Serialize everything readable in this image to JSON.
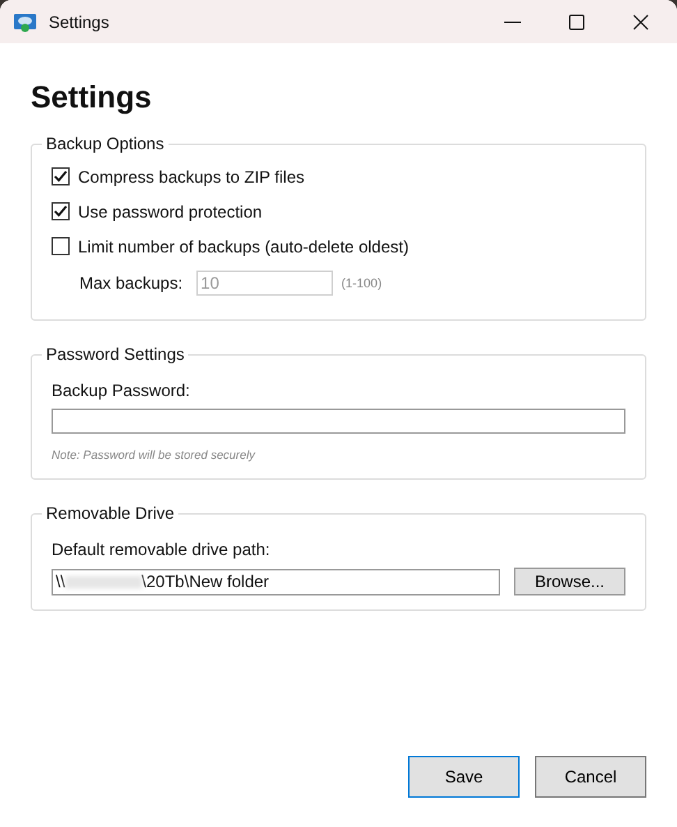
{
  "window": {
    "title": "Settings"
  },
  "heading": "Settings",
  "backup_options": {
    "title": "Backup Options",
    "checkboxes": [
      {
        "label": "Compress backups to ZIP files",
        "checked": true
      },
      {
        "label": "Use password protection",
        "checked": true
      },
      {
        "label": "Limit number of backups (auto-delete oldest)",
        "checked": false
      }
    ],
    "max_backups": {
      "label": "Max backups:",
      "value": "10",
      "disabled": true,
      "hint": "(1-100)"
    }
  },
  "password_settings": {
    "title": "Password Settings",
    "label": "Backup Password:",
    "note": "Note: Password will be stored securely"
  },
  "removable_drive": {
    "title": "Removable Drive",
    "label": "Default removable drive path:",
    "path_start": "\\\\",
    "path_end": "\\20Tb\\New folder",
    "browse": "Browse..."
  },
  "buttons": [
    {
      "label": "Save",
      "selected": true
    },
    {
      "label": "Cancel",
      "selected": false
    }
  ]
}
